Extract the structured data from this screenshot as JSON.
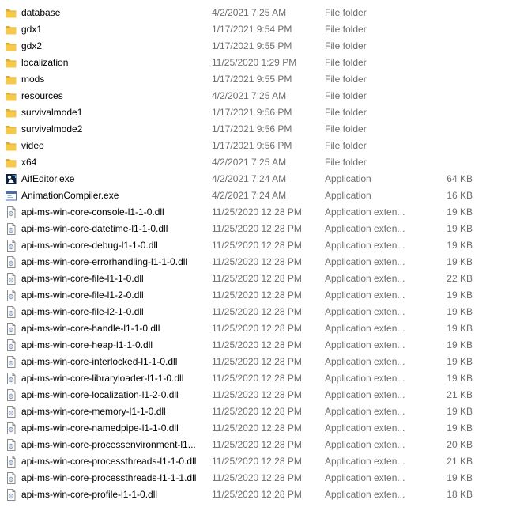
{
  "colors": {
    "folder": "#f7c948",
    "folder_dark": "#dcaa2a",
    "meta_text": "#6d6d6d",
    "hover": "#e5f3ff"
  },
  "files": [
    {
      "name": "database",
      "date": "4/2/2021 7:25 AM",
      "type": "File folder",
      "size": "",
      "icon": "folder-icon"
    },
    {
      "name": "gdx1",
      "date": "1/17/2021 9:54 PM",
      "type": "File folder",
      "size": "",
      "icon": "folder-icon"
    },
    {
      "name": "gdx2",
      "date": "1/17/2021 9:55 PM",
      "type": "File folder",
      "size": "",
      "icon": "folder-icon"
    },
    {
      "name": "localization",
      "date": "11/25/2020 1:29 PM",
      "type": "File folder",
      "size": "",
      "icon": "folder-icon"
    },
    {
      "name": "mods",
      "date": "1/17/2021 9:55 PM",
      "type": "File folder",
      "size": "",
      "icon": "folder-icon"
    },
    {
      "name": "resources",
      "date": "4/2/2021 7:25 AM",
      "type": "File folder",
      "size": "",
      "icon": "folder-icon"
    },
    {
      "name": "survivalmode1",
      "date": "1/17/2021 9:56 PM",
      "type": "File folder",
      "size": "",
      "icon": "folder-icon"
    },
    {
      "name": "survivalmode2",
      "date": "1/17/2021 9:56 PM",
      "type": "File folder",
      "size": "",
      "icon": "folder-icon"
    },
    {
      "name": "video",
      "date": "1/17/2021 9:56 PM",
      "type": "File folder",
      "size": "",
      "icon": "folder-icon"
    },
    {
      "name": "x64",
      "date": "4/2/2021 7:25 AM",
      "type": "File folder",
      "size": "",
      "icon": "folder-icon"
    },
    {
      "name": "AifEditor.exe",
      "date": "4/2/2021 7:24 AM",
      "type": "Application",
      "size": "64 KB",
      "icon": "aif-editor-app-icon"
    },
    {
      "name": "AnimationCompiler.exe",
      "date": "4/2/2021 7:24 AM",
      "type": "Application",
      "size": "16 KB",
      "icon": "application-window-icon"
    },
    {
      "name": "api-ms-win-core-console-l1-1-0.dll",
      "date": "11/25/2020 12:28 PM",
      "type": "Application exten...",
      "size": "19 KB",
      "icon": "dll-file-icon"
    },
    {
      "name": "api-ms-win-core-datetime-l1-1-0.dll",
      "date": "11/25/2020 12:28 PM",
      "type": "Application exten...",
      "size": "19 KB",
      "icon": "dll-file-icon"
    },
    {
      "name": "api-ms-win-core-debug-l1-1-0.dll",
      "date": "11/25/2020 12:28 PM",
      "type": "Application exten...",
      "size": "19 KB",
      "icon": "dll-file-icon"
    },
    {
      "name": "api-ms-win-core-errorhandling-l1-1-0.dll",
      "date": "11/25/2020 12:28 PM",
      "type": "Application exten...",
      "size": "19 KB",
      "icon": "dll-file-icon"
    },
    {
      "name": "api-ms-win-core-file-l1-1-0.dll",
      "date": "11/25/2020 12:28 PM",
      "type": "Application exten...",
      "size": "22 KB",
      "icon": "dll-file-icon"
    },
    {
      "name": "api-ms-win-core-file-l1-2-0.dll",
      "date": "11/25/2020 12:28 PM",
      "type": "Application exten...",
      "size": "19 KB",
      "icon": "dll-file-icon"
    },
    {
      "name": "api-ms-win-core-file-l2-1-0.dll",
      "date": "11/25/2020 12:28 PM",
      "type": "Application exten...",
      "size": "19 KB",
      "icon": "dll-file-icon"
    },
    {
      "name": "api-ms-win-core-handle-l1-1-0.dll",
      "date": "11/25/2020 12:28 PM",
      "type": "Application exten...",
      "size": "19 KB",
      "icon": "dll-file-icon"
    },
    {
      "name": "api-ms-win-core-heap-l1-1-0.dll",
      "date": "11/25/2020 12:28 PM",
      "type": "Application exten...",
      "size": "19 KB",
      "icon": "dll-file-icon"
    },
    {
      "name": "api-ms-win-core-interlocked-l1-1-0.dll",
      "date": "11/25/2020 12:28 PM",
      "type": "Application exten...",
      "size": "19 KB",
      "icon": "dll-file-icon"
    },
    {
      "name": "api-ms-win-core-libraryloader-l1-1-0.dll",
      "date": "11/25/2020 12:28 PM",
      "type": "Application exten...",
      "size": "19 KB",
      "icon": "dll-file-icon"
    },
    {
      "name": "api-ms-win-core-localization-l1-2-0.dll",
      "date": "11/25/2020 12:28 PM",
      "type": "Application exten...",
      "size": "21 KB",
      "icon": "dll-file-icon"
    },
    {
      "name": "api-ms-win-core-memory-l1-1-0.dll",
      "date": "11/25/2020 12:28 PM",
      "type": "Application exten...",
      "size": "19 KB",
      "icon": "dll-file-icon"
    },
    {
      "name": "api-ms-win-core-namedpipe-l1-1-0.dll",
      "date": "11/25/2020 12:28 PM",
      "type": "Application exten...",
      "size": "19 KB",
      "icon": "dll-file-icon"
    },
    {
      "name": "api-ms-win-core-processenvironment-l1...",
      "date": "11/25/2020 12:28 PM",
      "type": "Application exten...",
      "size": "20 KB",
      "icon": "dll-file-icon"
    },
    {
      "name": "api-ms-win-core-processthreads-l1-1-0.dll",
      "date": "11/25/2020 12:28 PM",
      "type": "Application exten...",
      "size": "21 KB",
      "icon": "dll-file-icon"
    },
    {
      "name": "api-ms-win-core-processthreads-l1-1-1.dll",
      "date": "11/25/2020 12:28 PM",
      "type": "Application exten...",
      "size": "19 KB",
      "icon": "dll-file-icon"
    },
    {
      "name": "api-ms-win-core-profile-l1-1-0.dll",
      "date": "11/25/2020 12:28 PM",
      "type": "Application exten...",
      "size": "18 KB",
      "icon": "dll-file-icon"
    }
  ]
}
